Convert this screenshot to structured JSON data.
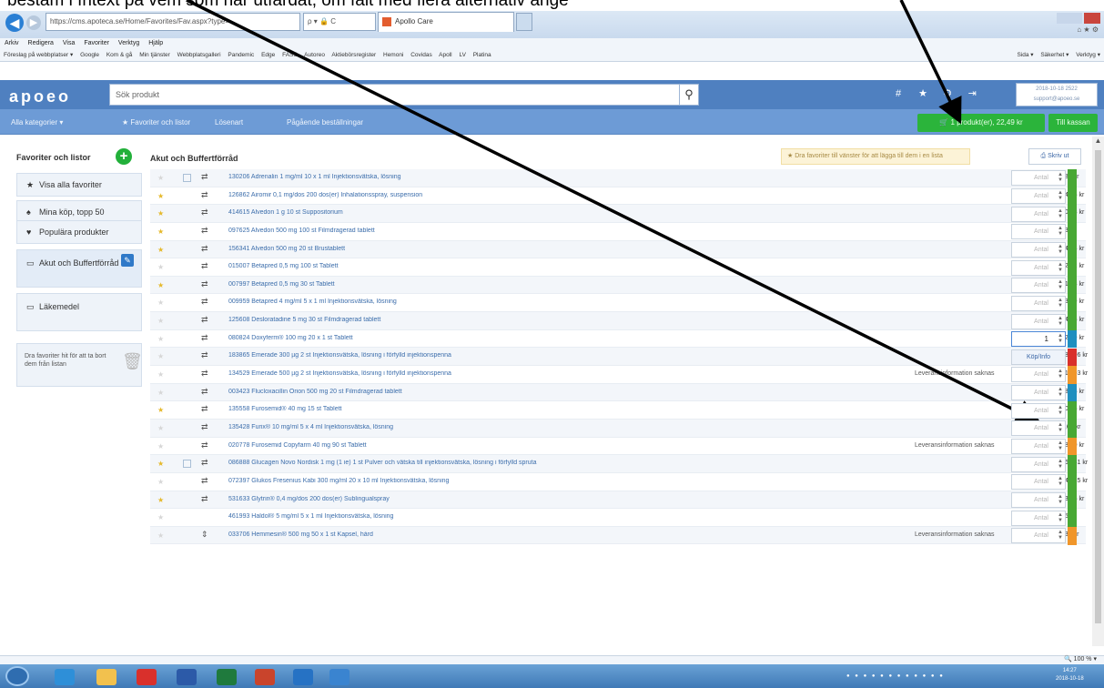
{
  "annotation": {
    "caption": "bestäm i fritext på vem som har utfärdat, om fält med flera alternativ ange"
  },
  "browser": {
    "address": "https://cms.apoteca.se/Home/Favorites/Fav.aspx?type=",
    "address_tools": "ρ ▾ 🔒 C",
    "tab_title": "Apollo Care",
    "menu": [
      "Arkiv",
      "Redigera",
      "Visa",
      "Favoriter",
      "Verktyg",
      "Hjälp"
    ],
    "favorites": [
      "Föreslag på webbplatser ▾",
      "Google",
      "Kom & gå",
      "Min tjänster",
      "Webbplatsgalleri",
      "Pandemic",
      "Edge",
      "FASS",
      "Autoreo",
      "Aktiebörsregister",
      "Hemoni",
      "Covidas",
      "Apoll",
      "LV",
      "Platina"
    ],
    "favorites_right": [
      "Sida ▾",
      "Säkerhet ▾",
      "Verktyg ▾"
    ],
    "zoom": "100 %"
  },
  "header": {
    "logo": "apoeo",
    "search_placeholder": "Sök produkt",
    "icons": [
      "#",
      "★",
      "⚙",
      "⇥"
    ],
    "user_line1": "2018-10-18 2522",
    "user_line2": "support@apoeo.se"
  },
  "nav": {
    "items": [
      "Alla kategorier ▾",
      "★ Favoriter och listor",
      "Lösenart",
      "Pågående beställningar"
    ],
    "cart": "1 produkt(er), 22,49 kr",
    "checkout": "Till kassan"
  },
  "sidebar": {
    "title": "Favoriter och listor",
    "items": [
      {
        "icon": "★",
        "label": "Visa alla favoriter"
      },
      {
        "icon": "♠",
        "label": "Mina köp, topp 50"
      },
      {
        "icon": "♥",
        "label": "Populära produkter"
      },
      {
        "icon": "▭",
        "label": "Akut och Buffertförråd"
      },
      {
        "icon": "▭",
        "label": "Läkemedel"
      }
    ],
    "trash_hint": "Dra favoriter hit för att ta bort dem från listan"
  },
  "main": {
    "title": "Akut och Buffertförråd",
    "hint": "★ Dra favoriter till vänster för att lägga till dem i en lista",
    "print": "Skriv ut",
    "quantity_placeholder": "Antal",
    "buy_label": "Köp/Info",
    "rows": [
      {
        "star": "off",
        "chk": true,
        "type": "⇄",
        "name": "130206 Adrenalin 1 mg/ml 10 x 1 ml Injektionsvätska, lösning",
        "info": "",
        "price": "380 kr",
        "qty": "",
        "stock": "#48a834"
      },
      {
        "star": "on",
        "chk": false,
        "type": "⇄",
        "name": "126862 Airomir 0,1 mg/dos 200 dos(er) Inhalationsspray, suspension",
        "info": "",
        "price": "24,15 kr",
        "qty": "",
        "stock": "#48a834"
      },
      {
        "star": "on",
        "chk": false,
        "type": "⇄",
        "name": "414615 Alvedon 1 g 10 st Suppositorium",
        "info": "",
        "price": "20,88 kr",
        "qty": "",
        "stock": "#48a834"
      },
      {
        "star": "on",
        "chk": false,
        "type": "⇄",
        "name": "097625 Alvedon 500 mg 100 st Filmdragerad tablett",
        "info": "",
        "price": "53 kr",
        "qty": "",
        "stock": "#48a834"
      },
      {
        "star": "on",
        "chk": false,
        "type": "⇄",
        "name": "156341 Alvedon 500 mg 20 st Brustablett",
        "info": "",
        "price": "24,34 kr",
        "qty": "",
        "stock": "#48a834"
      },
      {
        "star": "off",
        "chk": false,
        "type": "⇄",
        "name": "015007 Betapred 0,5 mg 100 st Tablett",
        "info": "",
        "price": "82,42 kr",
        "qty": "",
        "stock": "#48a834"
      },
      {
        "star": "on",
        "chk": false,
        "type": "⇄",
        "name": "007997 Betapred 0,5 mg 30 st Tablett",
        "info": "",
        "price": "31,58 kr",
        "qty": "",
        "stock": "#48a834"
      },
      {
        "star": "off",
        "chk": false,
        "type": "⇄",
        "name": "009959 Betapred 4 mg/ml 5 x 1 ml Injektionsvätska, lösning",
        "info": "",
        "price": "93,39 kr",
        "qty": "",
        "stock": "#48a834"
      },
      {
        "star": "off",
        "chk": false,
        "type": "⇄",
        "name": "125608 Desloratadine 5 mg 30 st Filmdragerad tablett",
        "info": "",
        "price": "34,76 kr",
        "qty": "",
        "stock": "#48a834"
      },
      {
        "star": "off",
        "chk": false,
        "type": "⇄",
        "name": "080824 Doxyferm® 100 mg 20 x 1 st Tablett",
        "info": "",
        "price": "22,49 kr",
        "qty": "1",
        "stock": "#1f8fbf"
      },
      {
        "star": "off",
        "chk": false,
        "type": "⇄",
        "name": "183865 Emerade 300 µg 2 st Injektionsvätska, lösning i förfylld injektionspenna",
        "info": "",
        "price": "680,96 kr",
        "qty": "buy",
        "stock": "#d9302c"
      },
      {
        "star": "off",
        "chk": false,
        "type": "⇄",
        "name": "134529 Emerade 500 µg 2 st Injektionsvätska, lösning i förfylld injektionspenna",
        "info": "Leveransinformation saknas",
        "price": "715,93 kr",
        "qty": "",
        "stock": "#f0962a"
      },
      {
        "star": "off",
        "chk": false,
        "type": "⇄",
        "name": "003423 Flucloxacillin Orion 500 mg 20 st Filmdragerad tablett",
        "info": "",
        "price": "58,48 kr",
        "qty": "",
        "stock": "#1f8fbf"
      },
      {
        "star": "on",
        "chk": false,
        "type": "⇄",
        "name": "135558 Furosemid® 40 mg 15 st Tablett",
        "info": "",
        "price": "20,75 kr",
        "qty": "",
        "stock": "#48a834"
      },
      {
        "star": "off",
        "chk": false,
        "type": "⇄",
        "name": "135428 Furix® 10 mg/ml 5 x 4 ml Injektionsvätska, lösning",
        "info": "",
        "price": "8,60 kr",
        "qty": "",
        "stock": "#48a834"
      },
      {
        "star": "off",
        "chk": false,
        "type": "⇄",
        "name": "020778 Furosemid Copyfarm 40 mg 90 st Tablett",
        "info": "Leveransinformation saknas",
        "price": "18,70 kr",
        "qty": "",
        "stock": "#f0962a"
      },
      {
        "star": "on",
        "chk": true,
        "type": "⇄",
        "name": "086888 Glucagen Novo Nordisk 1 mg (1 ie) 1 st Pulver och vätska till injektionsvätska, lösning i förfylld spruta",
        "info": "",
        "price": "162,31 kr",
        "qty": "",
        "stock": "#48a834"
      },
      {
        "star": "off",
        "chk": false,
        "type": "⇄",
        "name": "072397 Glukos Fresenius Kabi 300 mg/ml 20 x 10 ml Injektionsvätska, lösning",
        "info": "",
        "price": "141,25 kr",
        "qty": "",
        "stock": "#48a834"
      },
      {
        "star": "on",
        "chk": false,
        "type": "⇄",
        "name": "531633 Glytrin® 0,4 mg/dos 200 dos(er) Sublingualspray",
        "info": "",
        "price": "83,15 kr",
        "qty": "",
        "stock": "#48a834"
      },
      {
        "star": "off",
        "chk": false,
        "type": "",
        "name": "461993 Haldol® 5 mg/ml 5 x 1 ml Injektionsvätska, lösning",
        "info": "",
        "price": "65 kr",
        "qty": "",
        "stock": "#48a834"
      },
      {
        "star": "off",
        "chk": false,
        "type": "⇕",
        "name": "033706 Hemmesin® 500 mg 50 x 1 st Kapsel, hård",
        "info": "Leveransinformation saknas",
        "price": "330 kr",
        "qty": "",
        "stock": "#f0962a"
      }
    ]
  },
  "taskbar": {
    "clock_time": "14:27",
    "clock_date": "2018-10-18"
  }
}
